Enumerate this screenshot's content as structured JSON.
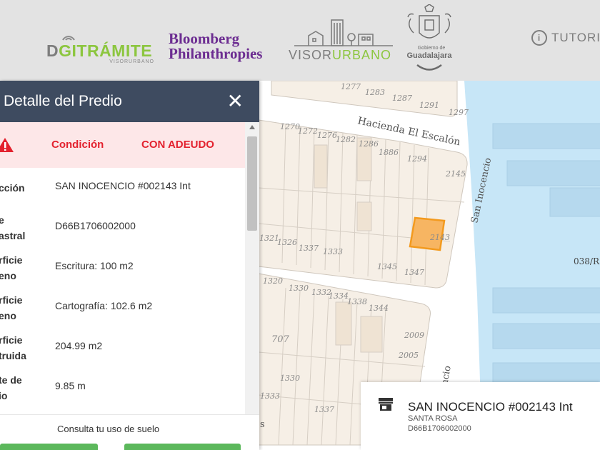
{
  "header": {
    "digitramite": {
      "prefix": "D",
      "mid": "GI",
      "main": "TRÁMITE",
      "sub": "VISORURBANO"
    },
    "bloomberg": {
      "line1": "Bloomberg",
      "line2": "Philanthropies"
    },
    "visorurbano": {
      "part1": "VISOR",
      "part2": "URBANO"
    },
    "guadalajara": {
      "line1": "Gobierno de",
      "line2": "Guadalajara"
    },
    "tutorial_label": "TUTORI",
    "info_glyph": "i"
  },
  "panel": {
    "title": "Detalle del Predio",
    "close_glyph": "✕",
    "status": {
      "label": "Condición",
      "value": "CON ADEUDO"
    },
    "rows": [
      {
        "label": "cción",
        "value": "SAN INOCENCIO #002143 Int"
      },
      {
        "label": "e\nastral",
        "value": "D66B1706002000"
      },
      {
        "label": "rficie\neno",
        "value": "Escritura: 100 m2"
      },
      {
        "label": "rficie\neno",
        "value": "Cartografía: 102.6 m2"
      },
      {
        "label": "rficie\ntruida",
        "value": "204.99 m2"
      },
      {
        "label": "te de\nio",
        "value": "9.85 m"
      }
    ],
    "footer_text": "Consulta tu uso de suelo"
  },
  "map": {
    "street1": "Hacienda El Escalón",
    "street2": "San Inocencio",
    "street3": "ncencio",
    "street4": "038/R",
    "street5": "s",
    "lot_numbers": [
      "1277",
      "1283",
      "1287",
      "1291",
      "1297",
      "1270",
      "1272",
      "1276",
      "1282",
      "1286",
      "1886",
      "1294",
      "2145",
      "2143",
      "1321",
      "1326",
      "1337",
      "1333",
      "1345",
      "1347",
      "1320",
      "1330",
      "1332",
      "1334",
      "1338",
      "1344",
      "707",
      "2009",
      "2005",
      "1337",
      "1333",
      "1330"
    ]
  },
  "card": {
    "title": "SAN INOCENCIO #002143 Int",
    "neighborhood": "SANTA ROSA",
    "code": "D66B1706002000"
  },
  "colors": {
    "header_bg": "#e3e3e3",
    "panel_head": "#3e4b60",
    "alert_red": "#e3212e",
    "alert_bg": "#fde7e8",
    "selected_lot": "#f7b562",
    "water": "#c7e6f7",
    "accent_green": "#8cc63f"
  }
}
